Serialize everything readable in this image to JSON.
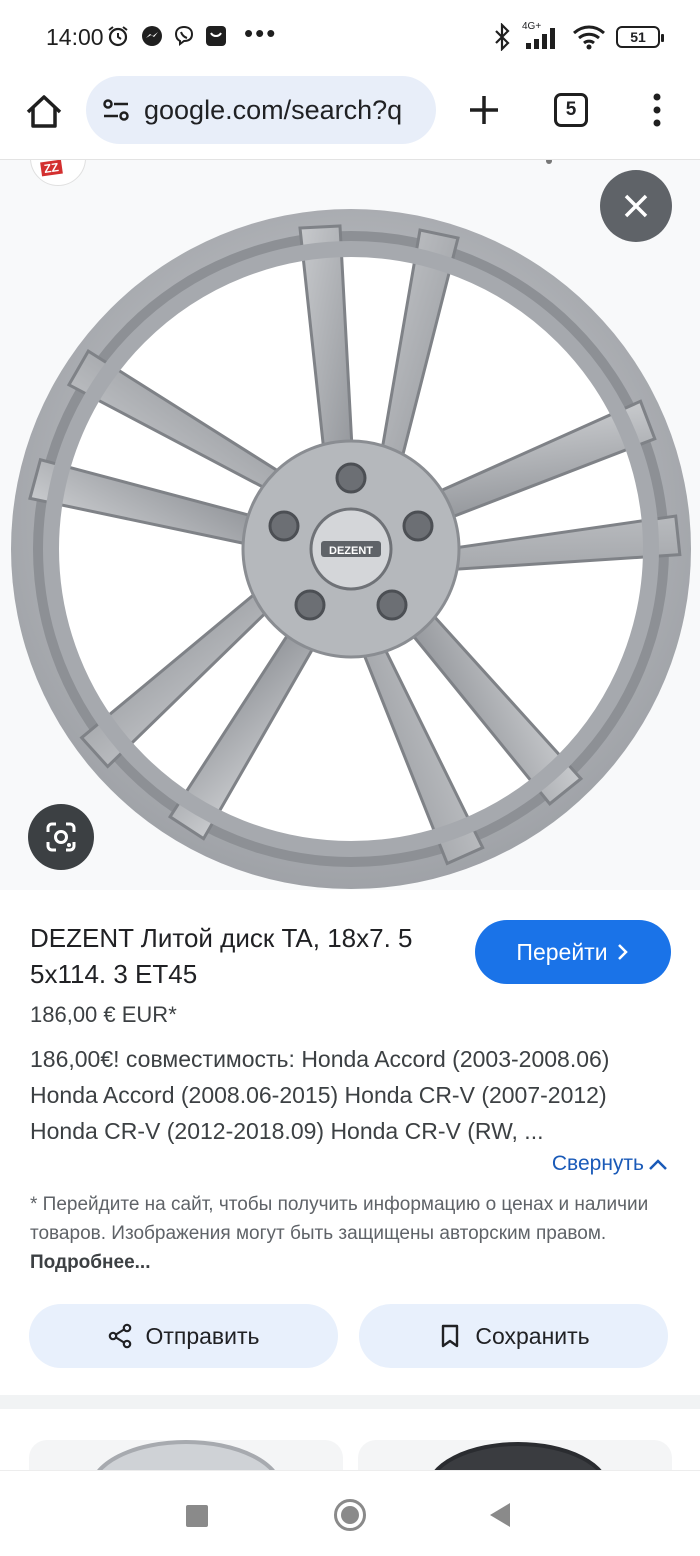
{
  "status_bar": {
    "time": "14:00",
    "network": "4G+",
    "battery": "51"
  },
  "browser": {
    "url": "google.com/search?q",
    "tab_count": "5"
  },
  "viewer": {
    "wheel_brand": "DEZENT"
  },
  "product": {
    "title": "DEZENT Литой диск TA, 18x7. 5 5x114. 3 ET45",
    "go_label": "Перейти",
    "price": "186,00 € EUR*",
    "description": "186,00€! совместимость: Honda Accord (2003-2008.06) Honda Accord (2008.06-2015) Honda CR-V (2007-2012) Honda CR-V (2012-2018.09) Honda CR-V (RW, ...",
    "collapse_label": "Свернуть",
    "disclaimer": "* Перейдите на сайт, чтобы получить информацию о ценах и наличии товаров. Изображения могут быть защищены авторским правом.",
    "more_label": "Подробнее...",
    "share_label": "Отправить",
    "save_label": "Сохранить"
  },
  "colors": {
    "accent": "#1a73e8",
    "url_bar_bg": "#e8eef9",
    "action_bg": "#e8f0fc"
  }
}
